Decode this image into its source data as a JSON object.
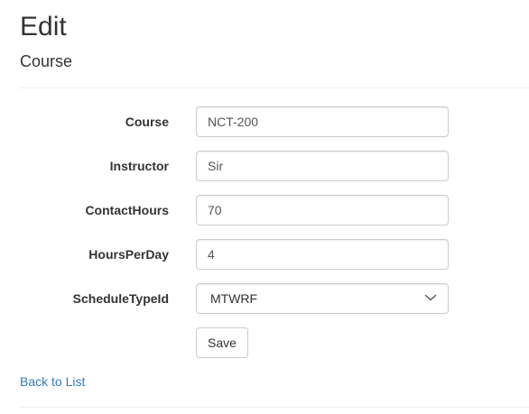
{
  "header": {
    "title": "Edit",
    "subtitle": "Course"
  },
  "form": {
    "fields": [
      {
        "label": "Course",
        "value": "NCT-200"
      },
      {
        "label": "Instructor",
        "value": "Sir"
      },
      {
        "label": "ContactHours",
        "value": "70"
      },
      {
        "label": "HoursPerDay",
        "value": "4"
      }
    ],
    "schedule": {
      "label": "ScheduleTypeId",
      "selected": "MTWRF"
    },
    "save_label": "Save"
  },
  "footer": {
    "back_label": "Back to List"
  },
  "icons": {
    "select_arrow": "chevron-down-icon"
  },
  "colors": {
    "link": "#337ab7",
    "text": "#333333",
    "border": "#cccccc",
    "rule": "#eeeeee"
  }
}
